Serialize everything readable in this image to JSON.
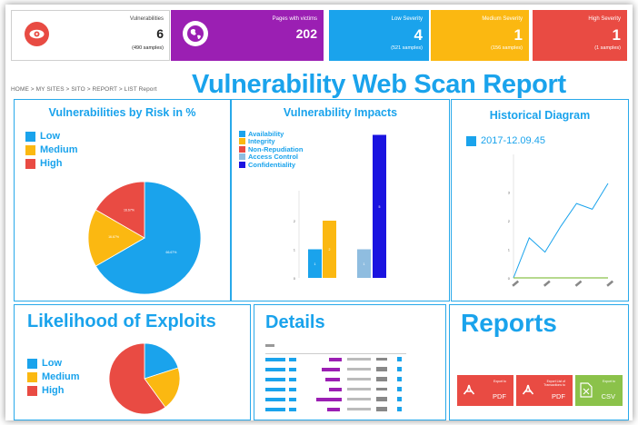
{
  "cards": {
    "vulnerabilities": {
      "label": "Vulnerabilities",
      "value": "6",
      "sub": "(490 samples)"
    },
    "pages": {
      "label": "Pages with victims",
      "value": "202"
    },
    "low": {
      "label": "Low Severity",
      "value": "4",
      "sub": "(521 samples)"
    },
    "medium": {
      "label": "Medium Severity",
      "value": "1",
      "sub": "(156 samples)"
    },
    "high": {
      "label": "High Severity",
      "value": "1",
      "sub": "(1 samples)"
    }
  },
  "breadcrumb": "HOME > MY SITES > SITO > REPORT > LIST Report",
  "page_title": "Vulnerability Web Scan Report",
  "colors": {
    "blue": "#1aa3ec",
    "yellow": "#fbb811",
    "red": "#e94b43",
    "purple": "#9b1fb3",
    "green": "#8bc24a",
    "lightblue": "#8fbde0",
    "navy": "#1a13e0",
    "darkred": "#c9302c"
  },
  "risk_panel": {
    "title": "Vulnerabilities by Risk in %",
    "legend": [
      "Low",
      "Medium",
      "High"
    ]
  },
  "impacts_panel": {
    "title": "Vulnerability Impacts",
    "legend": [
      "Availability",
      "Integrity",
      "Non-Repudiation",
      "Access Control",
      "Confidentiality"
    ]
  },
  "history_panel": {
    "title": "Historical Diagram",
    "legend": "2017-12.09.45"
  },
  "likelihood_panel": {
    "title": "Likelihood of Exploits",
    "legend": [
      "Low",
      "Medium",
      "High"
    ]
  },
  "details_panel": {
    "title": "Details"
  },
  "reports_panel": {
    "title": "Reports",
    "buttons": [
      {
        "tiny": "Export to",
        "main": "PDF"
      },
      {
        "tiny": "Export List of Transactions to",
        "main": "PDF"
      },
      {
        "tiny": "Export to",
        "main": "CSV"
      }
    ]
  },
  "chart_data": [
    {
      "type": "pie",
      "title": "Vulnerabilities by Risk in %",
      "categories": [
        "Low",
        "Medium",
        "High"
      ],
      "values": [
        66.67,
        16.67,
        16.67
      ],
      "data_labels": [
        "66.67%",
        "16.67%",
        "16.67%"
      ],
      "colors": [
        "#1aa3ec",
        "#fbb811",
        "#e94b43"
      ]
    },
    {
      "type": "bar",
      "title": "Vulnerability Impacts",
      "series": [
        {
          "name": "Availability",
          "values": [
            1
          ]
        },
        {
          "name": "Integrity",
          "values": [
            2
          ]
        },
        {
          "name": "Non-Repudiation",
          "values": [
            0
          ]
        },
        {
          "name": "Access Control",
          "values": [
            1
          ]
        },
        {
          "name": "Confidentiality",
          "values": [
            5
          ]
        }
      ],
      "ylim": [
        0,
        5
      ],
      "yticks": [
        "0",
        "1",
        "2"
      ]
    },
    {
      "type": "line",
      "title": "Historical Diagram",
      "series": [
        {
          "name": "2017-12.09.45",
          "values": [
            0,
            1.4,
            0.9,
            1.8,
            2.6,
            2.4,
            3.3
          ]
        },
        {
          "name": "",
          "values": [
            0,
            0,
            0,
            0,
            0,
            0,
            0
          ]
        }
      ],
      "yticks": [
        "0",
        "1",
        "2",
        "3"
      ]
    },
    {
      "type": "pie",
      "title": "Likelihood of Exploits",
      "categories": [
        "Low",
        "Medium",
        "High"
      ],
      "values": [
        20,
        20,
        60
      ],
      "colors": [
        "#1aa3ec",
        "#fbb811",
        "#e94b43"
      ]
    }
  ]
}
